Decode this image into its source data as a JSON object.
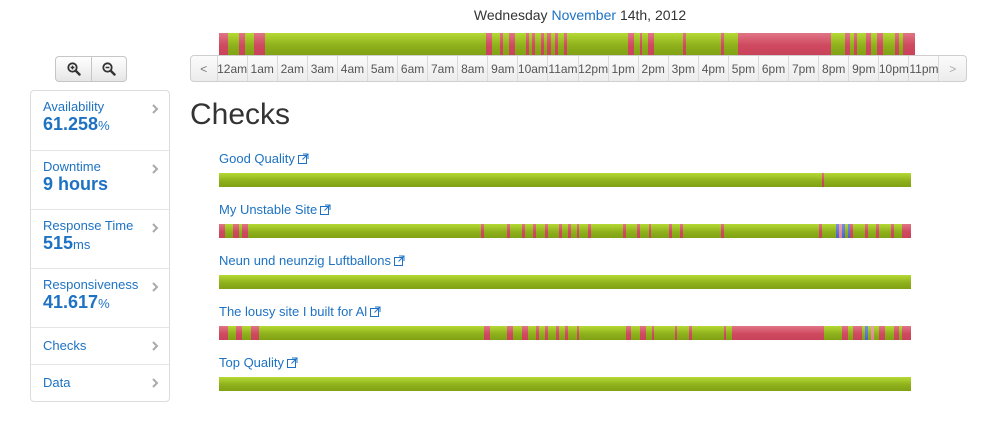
{
  "header": {
    "weekday": "Wednesday",
    "month": "November",
    "rest": "14th, 2012"
  },
  "zoom": {
    "in_icon": "zoom-in-icon",
    "out_icon": "zoom-out-icon"
  },
  "timeline": {
    "prev": "<",
    "next": ">",
    "hours": [
      "12am",
      "1am",
      "2am",
      "3am",
      "4am",
      "5am",
      "6am",
      "7am",
      "8am",
      "9am",
      "10am",
      "11am",
      "12pm",
      "1pm",
      "2pm",
      "3pm",
      "4pm",
      "5pm",
      "6pm",
      "7pm",
      "8pm",
      "9pm",
      "10pm",
      "11pm"
    ]
  },
  "overview_status": {
    "colors": {
      "up": "#8fb11c",
      "down": "#cf4a5f",
      "unknown": "#dd7f91",
      "paused": "#4a62c9"
    },
    "segments": [
      [
        "down",
        0.0,
        0.3
      ],
      [
        "down",
        0.7,
        0.9
      ],
      [
        "down",
        1.2,
        1.6
      ],
      [
        "down",
        9.2,
        9.4
      ],
      [
        "down",
        9.7,
        9.8
      ],
      [
        "down",
        10.0,
        10.2
      ],
      [
        "down",
        10.6,
        10.7
      ],
      [
        "down",
        10.8,
        10.9
      ],
      [
        "down",
        11.1,
        11.2
      ],
      [
        "down",
        11.3,
        11.45
      ],
      [
        "down",
        11.6,
        11.7
      ],
      [
        "down",
        11.9,
        12.0
      ],
      [
        "down",
        14.1,
        14.3
      ],
      [
        "down",
        14.5,
        14.6
      ],
      [
        "down",
        14.8,
        15.0
      ],
      [
        "down",
        16.0,
        16.1
      ],
      [
        "down",
        17.3,
        17.4
      ],
      [
        "down",
        17.9,
        21.1
      ],
      [
        "down",
        21.6,
        21.75
      ],
      [
        "down",
        21.9,
        22.0
      ],
      [
        "down",
        22.3,
        22.5
      ],
      [
        "down",
        22.7,
        22.9
      ],
      [
        "down",
        23.3,
        23.45
      ],
      [
        "down",
        23.6,
        24.0
      ]
    ]
  },
  "sidebar": {
    "stats": [
      {
        "label": "Availability",
        "value": "61.258",
        "unit": "%"
      },
      {
        "label": "Downtime",
        "value": "9 hours",
        "unit": ""
      },
      {
        "label": "Response Time",
        "value": "515",
        "unit": "ms"
      },
      {
        "label": "Responsiveness",
        "value": "41.617",
        "unit": "%"
      }
    ],
    "links": [
      "Checks",
      "Data"
    ]
  },
  "page_title": "Checks",
  "checks": [
    {
      "name": "Good Quality",
      "segments": [
        [
          "down",
          20.9,
          21.0
        ]
      ]
    },
    {
      "name": "My Unstable Site",
      "segments": [
        [
          "down",
          0.0,
          0.2
        ],
        [
          "down",
          0.5,
          0.7
        ],
        [
          "down",
          0.8,
          1.0
        ],
        [
          "down",
          9.1,
          9.2
        ],
        [
          "down",
          10.0,
          10.1
        ],
        [
          "down",
          10.5,
          10.6
        ],
        [
          "down",
          10.9,
          11.0
        ],
        [
          "down",
          11.3,
          11.4
        ],
        [
          "down",
          11.8,
          11.9
        ],
        [
          "down",
          12.1,
          12.2
        ],
        [
          "down",
          12.4,
          12.5
        ],
        [
          "down",
          12.8,
          12.9
        ],
        [
          "down",
          14.0,
          14.1
        ],
        [
          "down",
          14.5,
          14.6
        ],
        [
          "down",
          14.9,
          15.0
        ],
        [
          "down",
          15.6,
          15.7
        ],
        [
          "down",
          16.0,
          16.1
        ],
        [
          "down",
          17.4,
          17.5
        ],
        [
          "down",
          20.8,
          20.9
        ],
        [
          "paused",
          21.4,
          21.5
        ],
        [
          "paused",
          21.6,
          21.7
        ],
        [
          "paused",
          21.8,
          21.9
        ],
        [
          "unknown",
          21.5,
          21.6
        ],
        [
          "down",
          21.9,
          22.0
        ],
        [
          "down",
          22.4,
          22.5
        ],
        [
          "down",
          22.8,
          22.9
        ],
        [
          "down",
          23.3,
          23.4
        ],
        [
          "down",
          23.7,
          24.0
        ]
      ]
    },
    {
      "name": "Neun und neunzig Luftballons",
      "segments": []
    },
    {
      "name": "The lousy site I built for Al",
      "segments": [
        [
          "down",
          0.0,
          0.3
        ],
        [
          "down",
          0.6,
          0.8
        ],
        [
          "down",
          1.1,
          1.4
        ],
        [
          "down",
          9.2,
          9.4
        ],
        [
          "down",
          10.0,
          10.2
        ],
        [
          "down",
          10.5,
          10.7
        ],
        [
          "down",
          11.0,
          11.1
        ],
        [
          "down",
          11.3,
          11.4
        ],
        [
          "down",
          11.7,
          11.8
        ],
        [
          "down",
          12.0,
          12.1
        ],
        [
          "down",
          12.4,
          12.5
        ],
        [
          "down",
          14.1,
          14.3
        ],
        [
          "down",
          14.6,
          14.8
        ],
        [
          "down",
          15.0,
          15.1
        ],
        [
          "down",
          15.8,
          15.9
        ],
        [
          "down",
          16.3,
          16.4
        ],
        [
          "down",
          17.5,
          17.6
        ],
        [
          "down",
          17.8,
          21.0
        ],
        [
          "down",
          21.6,
          21.8
        ],
        [
          "down",
          22.0,
          22.3
        ],
        [
          "paused",
          22.4,
          22.5
        ],
        [
          "unknown",
          22.6,
          22.7
        ],
        [
          "down",
          22.9,
          23.1
        ],
        [
          "down",
          23.4,
          23.6
        ],
        [
          "down",
          23.7,
          24.0
        ]
      ]
    },
    {
      "name": "Top Quality",
      "segments": []
    }
  ]
}
